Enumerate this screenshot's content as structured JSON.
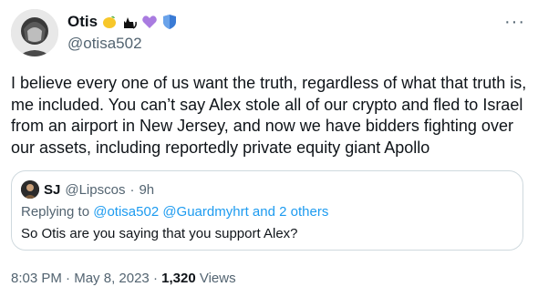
{
  "author": {
    "name": "Otis",
    "handle": "@otisa502",
    "emojis": [
      "lemon-icon",
      "black-cat-icon",
      "purple-heart-icon",
      "blue-shield-icon"
    ]
  },
  "tweet": {
    "text": "I believe every one of us want the truth, regardless of what that truth is, me included. You can’t say Alex stole all of our crypto and fled to Israel from an airport in New Jersey, and now we have bidders fighting over our assets, including reportedly private equity giant Apollo"
  },
  "quote": {
    "name": "SJ",
    "handle": "@Lipscos",
    "dot": "·",
    "time": "9h",
    "replying_prefix": "Replying to",
    "replying_mentions": "@otisa502 @Guardmyhrt",
    "replying_suffix": "and 2 others",
    "text": "So Otis are you saying that you support Alex?"
  },
  "meta": {
    "time": "8:03 PM",
    "date": "May 8, 2023",
    "views_count": "1,320",
    "views_label": "Views",
    "sep": "·"
  },
  "colors": {
    "accent": "#1d9bf0",
    "secondary_text": "#536471",
    "border": "#cfd9de"
  }
}
